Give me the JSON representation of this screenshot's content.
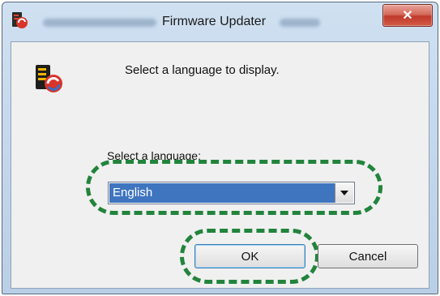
{
  "window": {
    "title": "Firmware Updater",
    "close_label": "✕"
  },
  "dialog": {
    "prompt": "Select a language to display.",
    "select_label": "Select a language:",
    "language_select": {
      "selected": "English"
    },
    "buttons": {
      "ok": "OK",
      "cancel": "Cancel"
    }
  },
  "colors": {
    "highlight_dash": "#22843c",
    "selection": "#3f75bf",
    "close_button": "#c0392b"
  }
}
